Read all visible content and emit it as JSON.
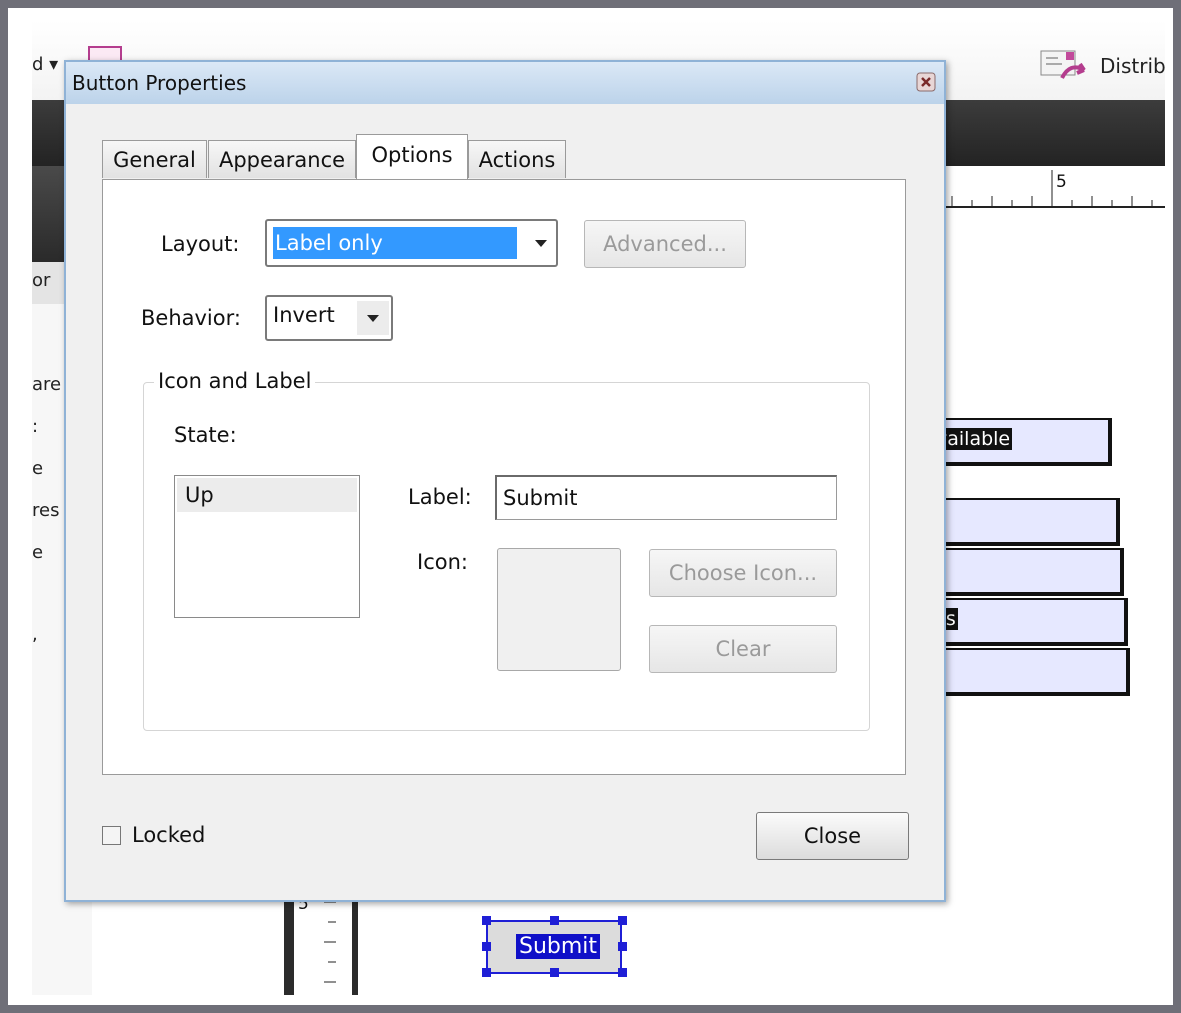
{
  "background_app": {
    "toolbar_fragment_left": "d ▾",
    "toolbar_distribute_label": "Distrib",
    "left_panel_fragments": [
      "or",
      "are",
      ":",
      "e",
      "res",
      "e",
      ","
    ],
    "ruler_top_number": "5",
    "ruler_left_number": "5",
    "field_texts": [
      "vailable",
      "",
      "",
      "ss",
      ""
    ],
    "submit_field_text": "Submit"
  },
  "dialog": {
    "title": "Button Properties",
    "tabs": [
      {
        "label": "General",
        "active": false
      },
      {
        "label": "Appearance",
        "active": false
      },
      {
        "label": "Options",
        "active": true
      },
      {
        "label": "Actions",
        "active": false
      }
    ],
    "options": {
      "layout_label": "Layout:",
      "layout_value": "Label only",
      "advanced_button": "Advanced...",
      "behavior_label": "Behavior:",
      "behavior_value": "Invert",
      "group_title": "Icon and Label",
      "state_label": "State:",
      "state_items": [
        "Up"
      ],
      "label_label": "Label:",
      "label_value": "Submit",
      "icon_label": "Icon:",
      "choose_icon_button": "Choose Icon...",
      "clear_button": "Clear"
    },
    "locked_label": "Locked",
    "locked_checked": false,
    "close_button": "Close"
  },
  "colors": {
    "selection_blue": "#3399ff",
    "title_bar": "#c7d9ee",
    "field_fill": "#e6e8ff"
  }
}
